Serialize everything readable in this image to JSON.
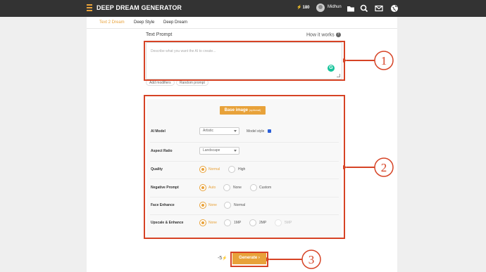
{
  "header": {
    "brand": "DEEP DREAM GENERATOR",
    "energy": "180",
    "username": "Midhun",
    "icons": [
      "folder-icon",
      "search-icon",
      "mail-icon",
      "globe-icon"
    ]
  },
  "tabs": [
    {
      "label": "Text 2 Dream",
      "active": true
    },
    {
      "label": "Deep Style",
      "active": false
    },
    {
      "label": "Deep Dream",
      "active": false
    }
  ],
  "prompt": {
    "title": "Text Prompt",
    "how_it_works": "How it works",
    "placeholder": "Describe what you want the AI to create...",
    "modifiers": [
      "Add modifiers",
      "Random prompt"
    ]
  },
  "base_image": {
    "label": "Base image",
    "optional": "(optional)"
  },
  "settings": {
    "ai_model": {
      "label": "AI Model",
      "value": "Artistic",
      "style_label": "Model style",
      "style_checked": true
    },
    "aspect_ratio": {
      "label": "Aspect Ratio",
      "value": "Landscape"
    },
    "quality": {
      "label": "Quality",
      "options": [
        "Normal",
        "High"
      ],
      "selected": "Normal"
    },
    "negative_prompt": {
      "label": "Negative Prompt",
      "options": [
        "Auto",
        "None",
        "Custom"
      ],
      "selected": "Auto"
    },
    "face_enhance": {
      "label": "Face Enhance",
      "options": [
        "None",
        "Normal"
      ],
      "selected": "None"
    },
    "upscale": {
      "label": "Upscale & Enhance",
      "options": [
        "None",
        "1MP",
        "2MP",
        "5MP"
      ],
      "selected": "None",
      "disabled": [
        "5MP"
      ]
    }
  },
  "generate": {
    "cost": "-5",
    "label": "Generate"
  },
  "annotations": [
    "1",
    "2",
    "3"
  ],
  "colors": {
    "accent": "#e8a23a",
    "annotation": "#d64325",
    "topbar": "#333333"
  }
}
